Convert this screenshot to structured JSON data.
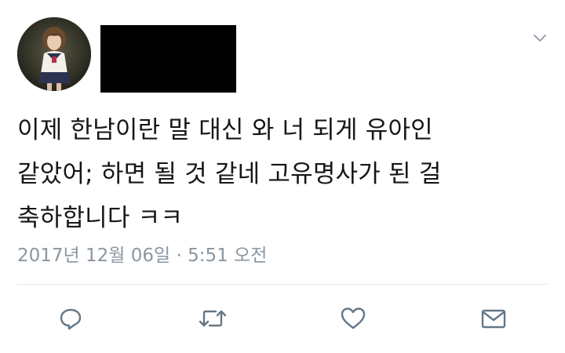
{
  "tweet": {
    "text_lines": [
      "이제 한남이란 말 대신 와 너 되게 유아인",
      "같았어; 하면 될 것 같네 고유명사가 된 걸",
      "축하합니다 ㅋㅋ"
    ],
    "timestamp": "2017년 12월 06일 · 5:51 오전"
  },
  "icons": {
    "menu": "chevron-down-icon",
    "reply": "reply-icon",
    "retweet": "retweet-icon",
    "like": "heart-icon",
    "message": "envelope-icon"
  },
  "colors": {
    "text": "#14171a",
    "secondary": "#8a96a0",
    "icon": "#657786",
    "divider": "#e1e8ed"
  }
}
